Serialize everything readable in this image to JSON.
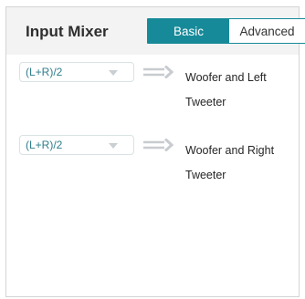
{
  "panel": {
    "title": "Input Mixer",
    "tabs": [
      {
        "label": "Basic",
        "active": true
      },
      {
        "label": "Advanced",
        "active": false
      }
    ]
  },
  "mixer_rows": [
    {
      "selected_value": "(L+R)/2",
      "target": "Woofer and Left Tweeter"
    },
    {
      "selected_value": "(L+R)/2",
      "target": "Woofer and Right Tweeter"
    }
  ],
  "colors": {
    "accent": "#178a99",
    "select_text": "#2f7d8b",
    "arrow": "#c8cbcf",
    "header_bg": "#f3f3f3"
  },
  "icons": {
    "dropdown": "caret-down-icon",
    "route": "double-line-arrow-right-icon"
  }
}
